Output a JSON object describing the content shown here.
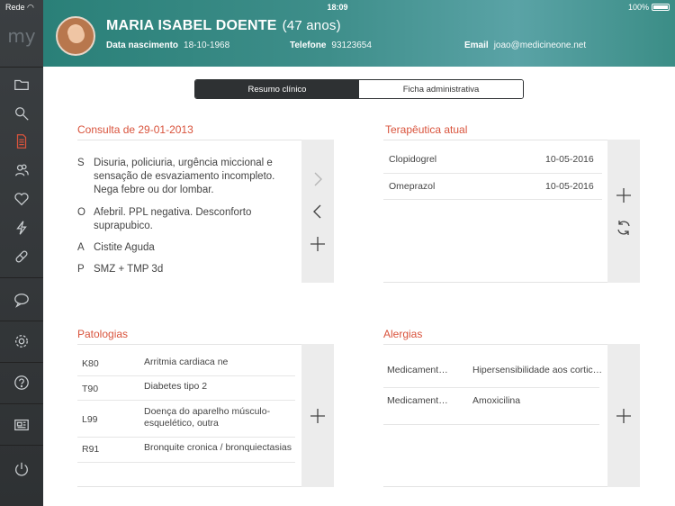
{
  "status": {
    "carrier": "Rede",
    "time": "18:09",
    "battery": "100%"
  },
  "sidebar": {
    "logo": "my"
  },
  "patient": {
    "name": "MARIA ISABEL DOENTE",
    "age": "(47 anos)",
    "birth_label": "Data nascimento",
    "birth_value": "18-10-1968",
    "phone_label": "Telefone",
    "phone_value": "93123654",
    "email_label": "Email",
    "email_value": "joao@medicineone.net"
  },
  "tabs": {
    "active": "Resumo clínico",
    "inactive": "Ficha administrativa"
  },
  "consulta": {
    "title": "Consulta de 29-01-2013",
    "entries": [
      {
        "key": "S",
        "lines": [
          "Disuria, policiuria, urgência miccional e",
          "sensação de esvaziamento incompleto.",
          "Nega febre ou dor lombar."
        ]
      },
      {
        "key": "O",
        "lines": [
          "Afebril. PPL negativa. Desconforto",
          "suprapubico."
        ]
      },
      {
        "key": "A",
        "lines": [
          "Cistite Aguda"
        ]
      },
      {
        "key": "P",
        "lines": [
          "SMZ + TMP 3d"
        ]
      }
    ]
  },
  "terapeutica": {
    "title": "Terapêutica atual",
    "items": [
      {
        "name": "Clopidogrel",
        "date": "10-05-2016"
      },
      {
        "name": "Omeprazol",
        "date": "10-05-2016"
      }
    ]
  },
  "patologias": {
    "title": "Patologias",
    "items": [
      {
        "code": "K80",
        "desc": [
          "Arritmia cardiaca ne"
        ]
      },
      {
        "code": "T90",
        "desc": [
          "Diabetes tipo 2"
        ]
      },
      {
        "code": "L99",
        "desc": [
          "Doença do aparelho músculo-",
          "esquelético, outra"
        ]
      },
      {
        "code": "R91",
        "desc": [
          "Bronquite cronica / bronquiectasias"
        ]
      }
    ]
  },
  "alergias": {
    "title": "Alergias",
    "items": [
      {
        "type": "Medicament…",
        "desc": "Hipersensibilidade aos cortic…"
      },
      {
        "type": "Medicament…",
        "desc": "Amoxicilina"
      }
    ]
  },
  "colors": {
    "accent": "#d9533c",
    "header": "#3e8e8a",
    "sidebar": "#2e3133",
    "active_icon": "#d9533c"
  }
}
